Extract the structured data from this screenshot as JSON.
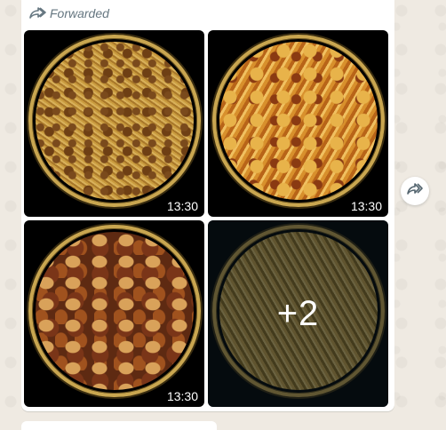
{
  "message": {
    "forwarded_label": "Forwarded",
    "images": [
      {
        "timestamp": "13:30",
        "alt": "bowl of sev and chana mix"
      },
      {
        "timestamp": "13:30",
        "alt": "bowl of spicy namkeen mix"
      },
      {
        "timestamp": "13:30",
        "alt": "bowl of roasted mixed nuts"
      },
      {
        "timestamp": "",
        "alt": "bowl of bhujia mix"
      }
    ],
    "more_count": "+2"
  },
  "colors": {
    "wallpaper": "#efeae2",
    "bubble": "#ffffff",
    "meta_text": "#667781",
    "gold_rim": "#c9a650"
  },
  "icons": {
    "forwarded": "forward-arrow-icon",
    "forward_action": "forward-arrow-icon"
  }
}
